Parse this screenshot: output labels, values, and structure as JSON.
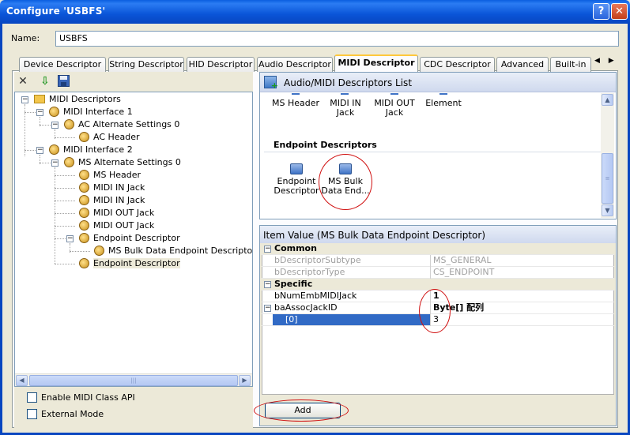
{
  "window": {
    "title": "Configure 'USBFS'",
    "help_glyph": "?",
    "close_glyph": "✕"
  },
  "name": {
    "label": "Name:",
    "value": "USBFS"
  },
  "tabs": [
    {
      "label": "Device Descriptor"
    },
    {
      "label": "String Descriptor"
    },
    {
      "label": "HID Descriptor"
    },
    {
      "label": "Audio Descriptor"
    },
    {
      "label": "MIDI Descriptor",
      "active": true
    },
    {
      "label": "CDC Descriptor"
    },
    {
      "label": "Advanced"
    },
    {
      "label": "Built-in"
    }
  ],
  "tab_scroll": "◀ ▶",
  "toolbar": {
    "delete_icon": "close-icon",
    "import_icon": "down-arrow-icon",
    "save_icon": "save-icon"
  },
  "tree": {
    "items": [
      {
        "label": "MIDI Descriptors"
      },
      {
        "label": "MIDI Interface 1"
      },
      {
        "label": "AC Alternate Settings 0"
      },
      {
        "label": "AC Header"
      },
      {
        "label": "MIDI Interface 2"
      },
      {
        "label": "MS Alternate Settings 0"
      },
      {
        "label": "MS Header"
      },
      {
        "label": "MIDI IN Jack"
      },
      {
        "label": "MIDI IN Jack"
      },
      {
        "label": "MIDI OUT Jack"
      },
      {
        "label": "MIDI OUT Jack"
      },
      {
        "label": "Endpoint Descriptor"
      },
      {
        "label": "MS Bulk Data Endpoint Descriptor"
      },
      {
        "label": "Endpoint Descriptor"
      }
    ],
    "scroll_grip": "|||"
  },
  "options": {
    "enable_midi_class_api": "Enable MIDI Class API",
    "external_mode": "External Mode"
  },
  "descriptor_list": {
    "title": "Audio/MIDI Descriptors List",
    "top_items": [
      {
        "line1": "MS Header",
        "line2": ""
      },
      {
        "line1": "MIDI IN",
        "line2": "Jack"
      },
      {
        "line1": "MIDI OUT",
        "line2": "Jack"
      },
      {
        "line1": "Element",
        "line2": ""
      }
    ],
    "section_title": "Endpoint Descriptors",
    "endpoint_items": [
      {
        "line1": "Endpoint",
        "line2": "Descriptor"
      },
      {
        "line1": "MS Bulk",
        "line2": "Data End..."
      }
    ],
    "scroll_up": "▲",
    "scroll_down": "▼",
    "scroll_grip": "≡"
  },
  "item_value": {
    "title": "Item Value (MS Bulk Data Endpoint Descriptor)",
    "rows": [
      {
        "kind": "category",
        "key": "Common",
        "toggle": "−"
      },
      {
        "kind": "dim",
        "key": "bDescriptorSubtype",
        "value": "MS_GENERAL"
      },
      {
        "kind": "dim",
        "key": "bDescriptorType",
        "value": "CS_ENDPOINT"
      },
      {
        "kind": "category",
        "key": "Specific",
        "toggle": "−"
      },
      {
        "kind": "normal",
        "key": "bNumEmbMIDIJack",
        "value": "1"
      },
      {
        "kind": "expandable",
        "key": "baAssocJackID",
        "value": "Byte[] 配列",
        "toggle": "−"
      },
      {
        "kind": "selected",
        "key": "[0]",
        "value": "3"
      }
    ]
  },
  "add_button": "Add"
}
